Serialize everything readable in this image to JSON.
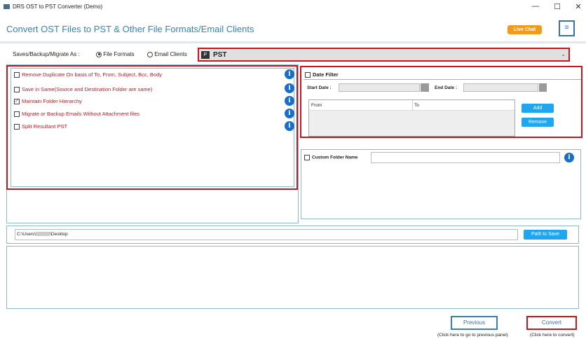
{
  "window": {
    "title": "DRS OST to PST Converter (Demo)",
    "minimize": "—",
    "maximize": "☐",
    "close": "✕"
  },
  "header": {
    "title": "Convert OST Files to PST & Other File Formats/Email Clients",
    "live_chat": "Live Chat",
    "menu_icon": "≡"
  },
  "save_as": {
    "label": "Saves/Backup/Migrate As :",
    "radio_file_formats": "File Formats",
    "radio_email_clients": "Email Clients",
    "selected": "file_formats",
    "format_value": "PST"
  },
  "options": [
    {
      "label": "Remove Duplicate On basis of To, From, Subject, Bcc, Body",
      "checked": false
    },
    {
      "label": "Save in Same(Source and Destination Folder are same)",
      "checked": false
    },
    {
      "label": "Maintain Folder Hierarchy",
      "checked": true
    },
    {
      "label": "Migrate or Backup Emails Without Attachment files",
      "checked": false
    },
    {
      "label": "Split Resultant PST",
      "checked": false
    }
  ],
  "date_filter": {
    "label": "Date Filter",
    "checked": false,
    "start_label": "Start Date :",
    "end_label": "End Date :",
    "start_value": "",
    "end_value": "",
    "col_from": "From",
    "col_to": "To",
    "add": "Add",
    "remove": "Remove"
  },
  "custom_folder": {
    "label": "Custom Folder Name",
    "checked": false,
    "value": ""
  },
  "path": {
    "prefix": "C:\\Users\\",
    "suffix": "\\Desktop",
    "button": "Path to Save"
  },
  "footer": {
    "previous": "Previous",
    "previous_caption": "(Click here to go to previous panel)",
    "convert": "Convert",
    "convert_caption": "(Click here to convert)"
  }
}
